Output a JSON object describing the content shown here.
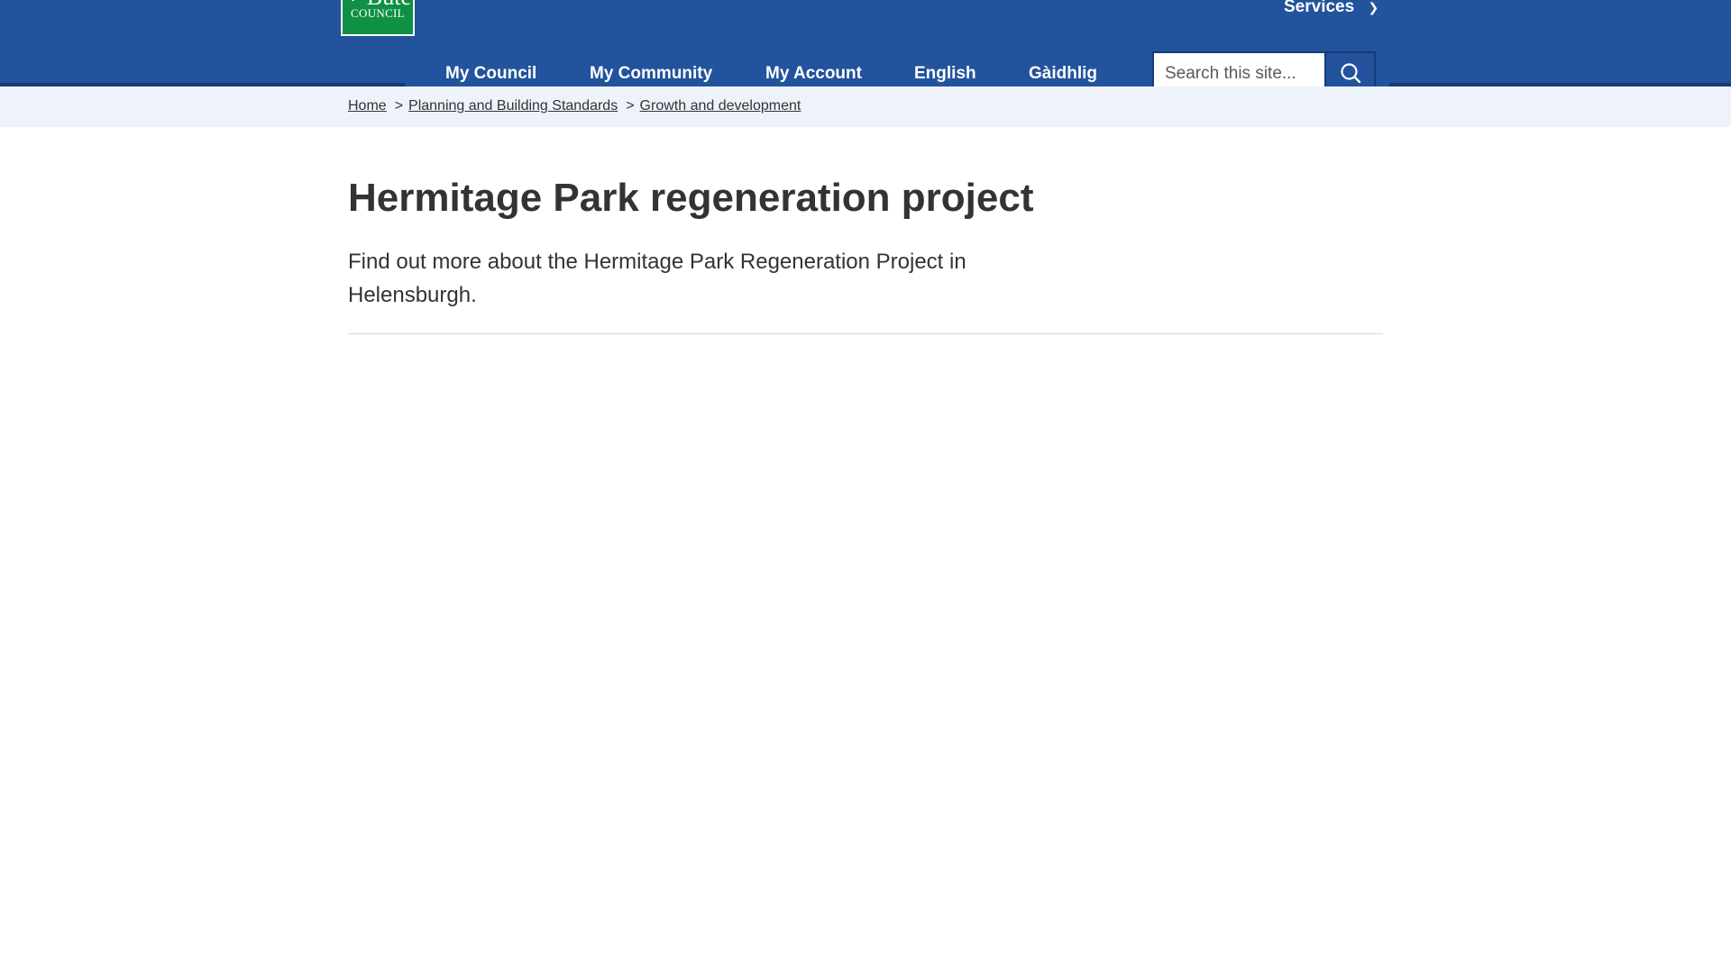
{
  "header": {
    "logo": {
      "line1": "Bute",
      "line2": "COUNCIL"
    },
    "services_label": "Services",
    "nav": [
      {
        "label": "My Council"
      },
      {
        "label": "My Community"
      },
      {
        "label": "My Account"
      },
      {
        "label": "English"
      },
      {
        "label": "Gàidhlig"
      }
    ],
    "search": {
      "placeholder": "Search this site...",
      "value": ""
    }
  },
  "breadcrumb": {
    "home": "Home",
    "separator": ">",
    "items": [
      "Planning and Building Standards",
      "Growth and development"
    ]
  },
  "page": {
    "title": "Hermitage Park regeneration project",
    "summary": "Find out more about the Hermitage Park Regeneration Project in Helensburgh."
  },
  "colors": {
    "header_blue": "#22539c",
    "header_dark": "#143c78",
    "logo_green": "#109044",
    "breadcrumb_band": "#eef3fb",
    "text": "#333333"
  }
}
